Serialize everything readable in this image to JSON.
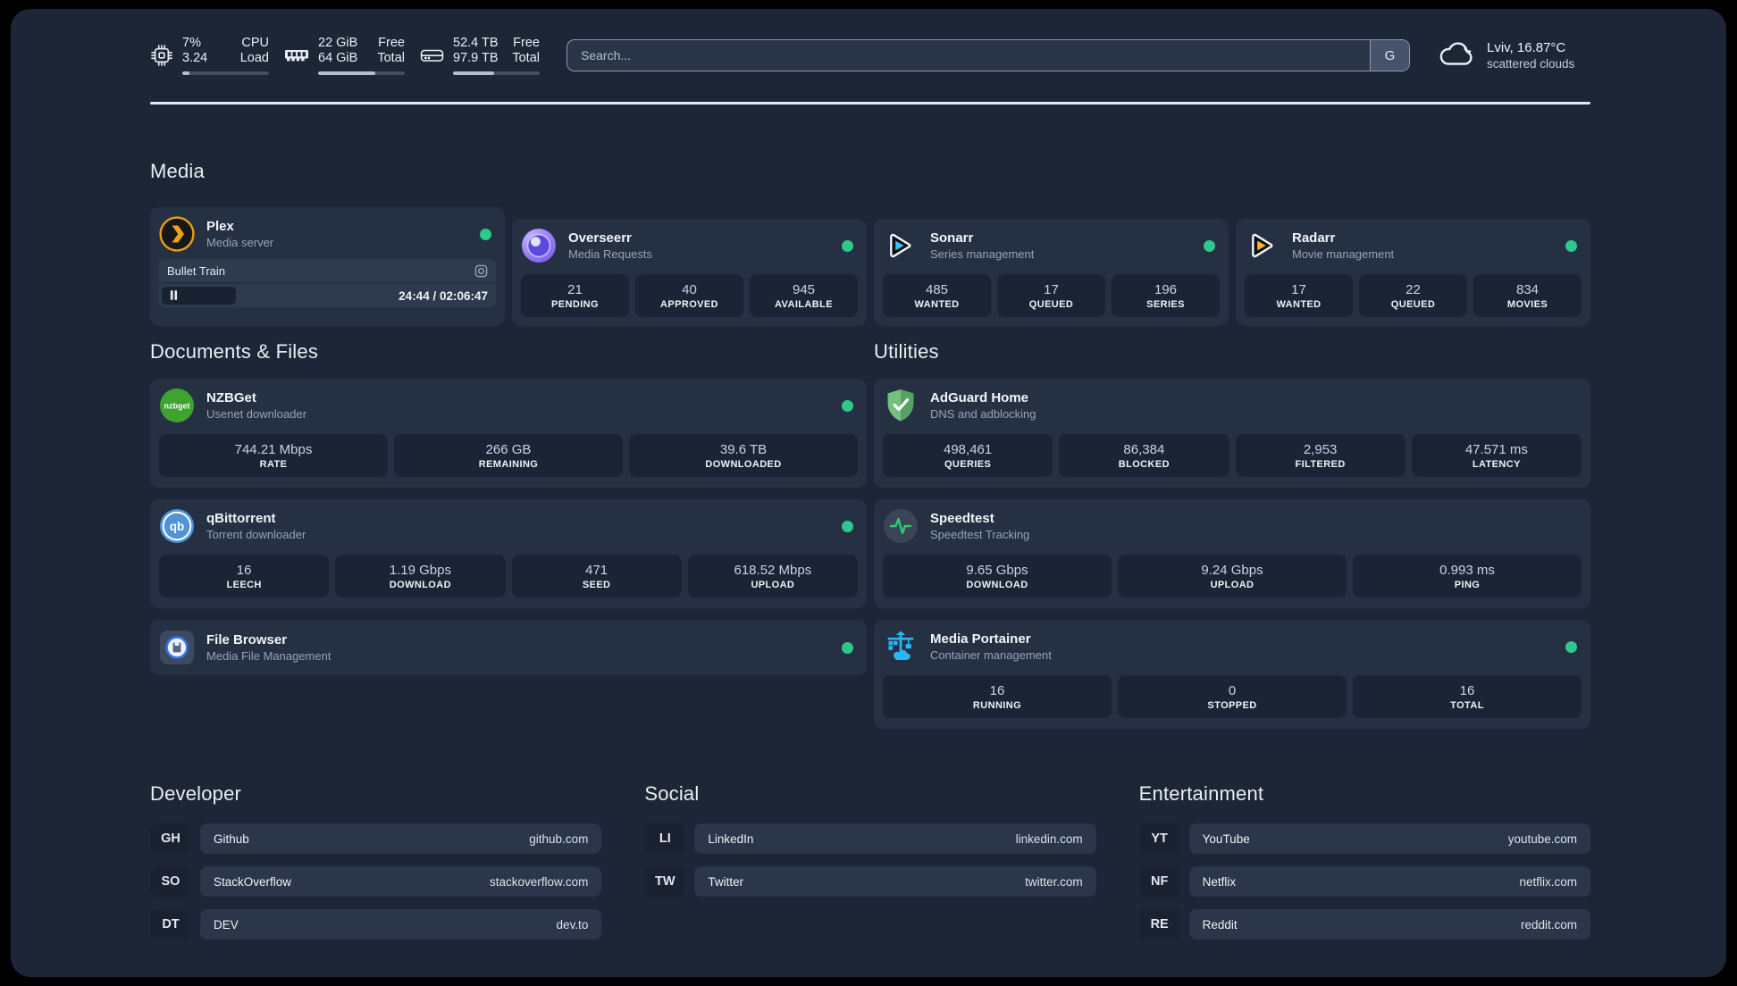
{
  "header": {
    "metrics": [
      {
        "icon": "cpu-icon",
        "value1": "7%",
        "value2": "3.24",
        "label1": "CPU",
        "label2": "Load",
        "progress_pct": 8
      },
      {
        "icon": "memory-icon",
        "value1": "22 GiB",
        "value2": "64 GiB",
        "label1": "Free",
        "label2": "Total",
        "progress_pct": 66
      },
      {
        "icon": "storage-icon",
        "value1": "52.4 TB",
        "value2": "97.9 TB",
        "label1": "Free",
        "label2": "Total",
        "progress_pct": 47
      }
    ],
    "search": {
      "placeholder": "Search...",
      "button_label": "G"
    },
    "weather": {
      "icon": "cloud-icon",
      "title": "Lviv, 16.87°C",
      "subtitle": "scattered clouds"
    }
  },
  "media": {
    "title": "Media",
    "plex": {
      "icon": "plex-icon",
      "title": "Plex",
      "subtitle": "Media server",
      "online": true,
      "now_playing": {
        "name": "Bullet Train",
        "time_display": "24:44 / 02:06:47",
        "progress_pct": 22
      }
    },
    "overseerr": {
      "icon": "overseerr-icon",
      "title": "Overseerr",
      "subtitle": "Media Requests",
      "online": true,
      "stats": [
        {
          "value": "21",
          "label": "PENDING"
        },
        {
          "value": "40",
          "label": "APPROVED"
        },
        {
          "value": "945",
          "label": "AVAILABLE"
        }
      ]
    },
    "sonarr": {
      "icon": "sonarr-icon",
      "title": "Sonarr",
      "subtitle": "Series management",
      "online": true,
      "stats": [
        {
          "value": "485",
          "label": "WANTED"
        },
        {
          "value": "17",
          "label": "QUEUED"
        },
        {
          "value": "196",
          "label": "SERIES"
        }
      ]
    },
    "radarr": {
      "icon": "radarr-icon",
      "title": "Radarr",
      "subtitle": "Movie management",
      "online": true,
      "stats": [
        {
          "value": "17",
          "label": "WANTED"
        },
        {
          "value": "22",
          "label": "QUEUED"
        },
        {
          "value": "834",
          "label": "MOVIES"
        }
      ]
    }
  },
  "documents": {
    "title": "Documents & Files",
    "nzbget": {
      "icon": "nzbget-icon",
      "title": "NZBGet",
      "subtitle": "Usenet downloader",
      "online": true,
      "stats": [
        {
          "value": "744.21 Mbps",
          "label": "RATE"
        },
        {
          "value": "266 GB",
          "label": "REMAINING"
        },
        {
          "value": "39.6 TB",
          "label": "DOWNLOADED"
        }
      ]
    },
    "qbittorrent": {
      "icon": "qbittorrent-icon",
      "title": "qBittorrent",
      "subtitle": "Torrent downloader",
      "online": true,
      "stats": [
        {
          "value": "16",
          "label": "LEECH"
        },
        {
          "value": "1.19 Gbps",
          "label": "DOWNLOAD"
        },
        {
          "value": "471",
          "label": "SEED"
        },
        {
          "value": "618.52 Mbps",
          "label": "UPLOAD"
        }
      ]
    },
    "filebrowser": {
      "icon": "filebrowser-icon",
      "title": "File Browser",
      "subtitle": "Media File Management",
      "online": true
    }
  },
  "utilities": {
    "title": "Utilities",
    "adguard": {
      "icon": "adguard-icon",
      "title": "AdGuard Home",
      "subtitle": "DNS and adblocking",
      "stats": [
        {
          "value": "498,461",
          "label": "QUERIES"
        },
        {
          "value": "86,384",
          "label": "BLOCKED"
        },
        {
          "value": "2,953",
          "label": "FILTERED"
        },
        {
          "value": "47.571 ms",
          "label": "LATENCY"
        }
      ]
    },
    "speedtest": {
      "icon": "speedtest-icon",
      "title": "Speedtest",
      "subtitle": "Speedtest Tracking",
      "stats": [
        {
          "value": "9.65 Gbps",
          "label": "DOWNLOAD"
        },
        {
          "value": "9.24 Gbps",
          "label": "UPLOAD"
        },
        {
          "value": "0.993 ms",
          "label": "PING"
        }
      ]
    },
    "portainer": {
      "icon": "portainer-icon",
      "title": "Media Portainer",
      "subtitle": "Container management",
      "online": true,
      "stats": [
        {
          "value": "16",
          "label": "RUNNING"
        },
        {
          "value": "0",
          "label": "STOPPED"
        },
        {
          "value": "16",
          "label": "TOTAL"
        }
      ]
    }
  },
  "links": {
    "developer": {
      "title": "Developer",
      "items": [
        {
          "abbr": "GH",
          "name": "Github",
          "url": "github.com"
        },
        {
          "abbr": "SO",
          "name": "StackOverflow",
          "url": "stackoverflow.com"
        },
        {
          "abbr": "DT",
          "name": "DEV",
          "url": "dev.to"
        }
      ]
    },
    "social": {
      "title": "Social",
      "items": [
        {
          "abbr": "LI",
          "name": "LinkedIn",
          "url": "linkedin.com"
        },
        {
          "abbr": "TW",
          "name": "Twitter",
          "url": "twitter.com"
        }
      ]
    },
    "entertainment": {
      "title": "Entertainment",
      "items": [
        {
          "abbr": "YT",
          "name": "YouTube",
          "url": "youtube.com"
        },
        {
          "abbr": "NF",
          "name": "Netflix",
          "url": "netflix.com"
        },
        {
          "abbr": "RE",
          "name": "Reddit",
          "url": "reddit.com"
        }
      ]
    }
  },
  "colors": {
    "status_online": "#2dc98b",
    "plex_orange": "#eda314",
    "sonarr_blue": "#35c5f4",
    "radarr_yellow": "#ffb91e",
    "nzbget_green": "#3fa32f",
    "qbittorrent_blue": "#4f94d6",
    "adguard_green": "#63b16c",
    "speedtest_green": "#2ecc71",
    "portainer_blue": "#2cb5f3"
  }
}
